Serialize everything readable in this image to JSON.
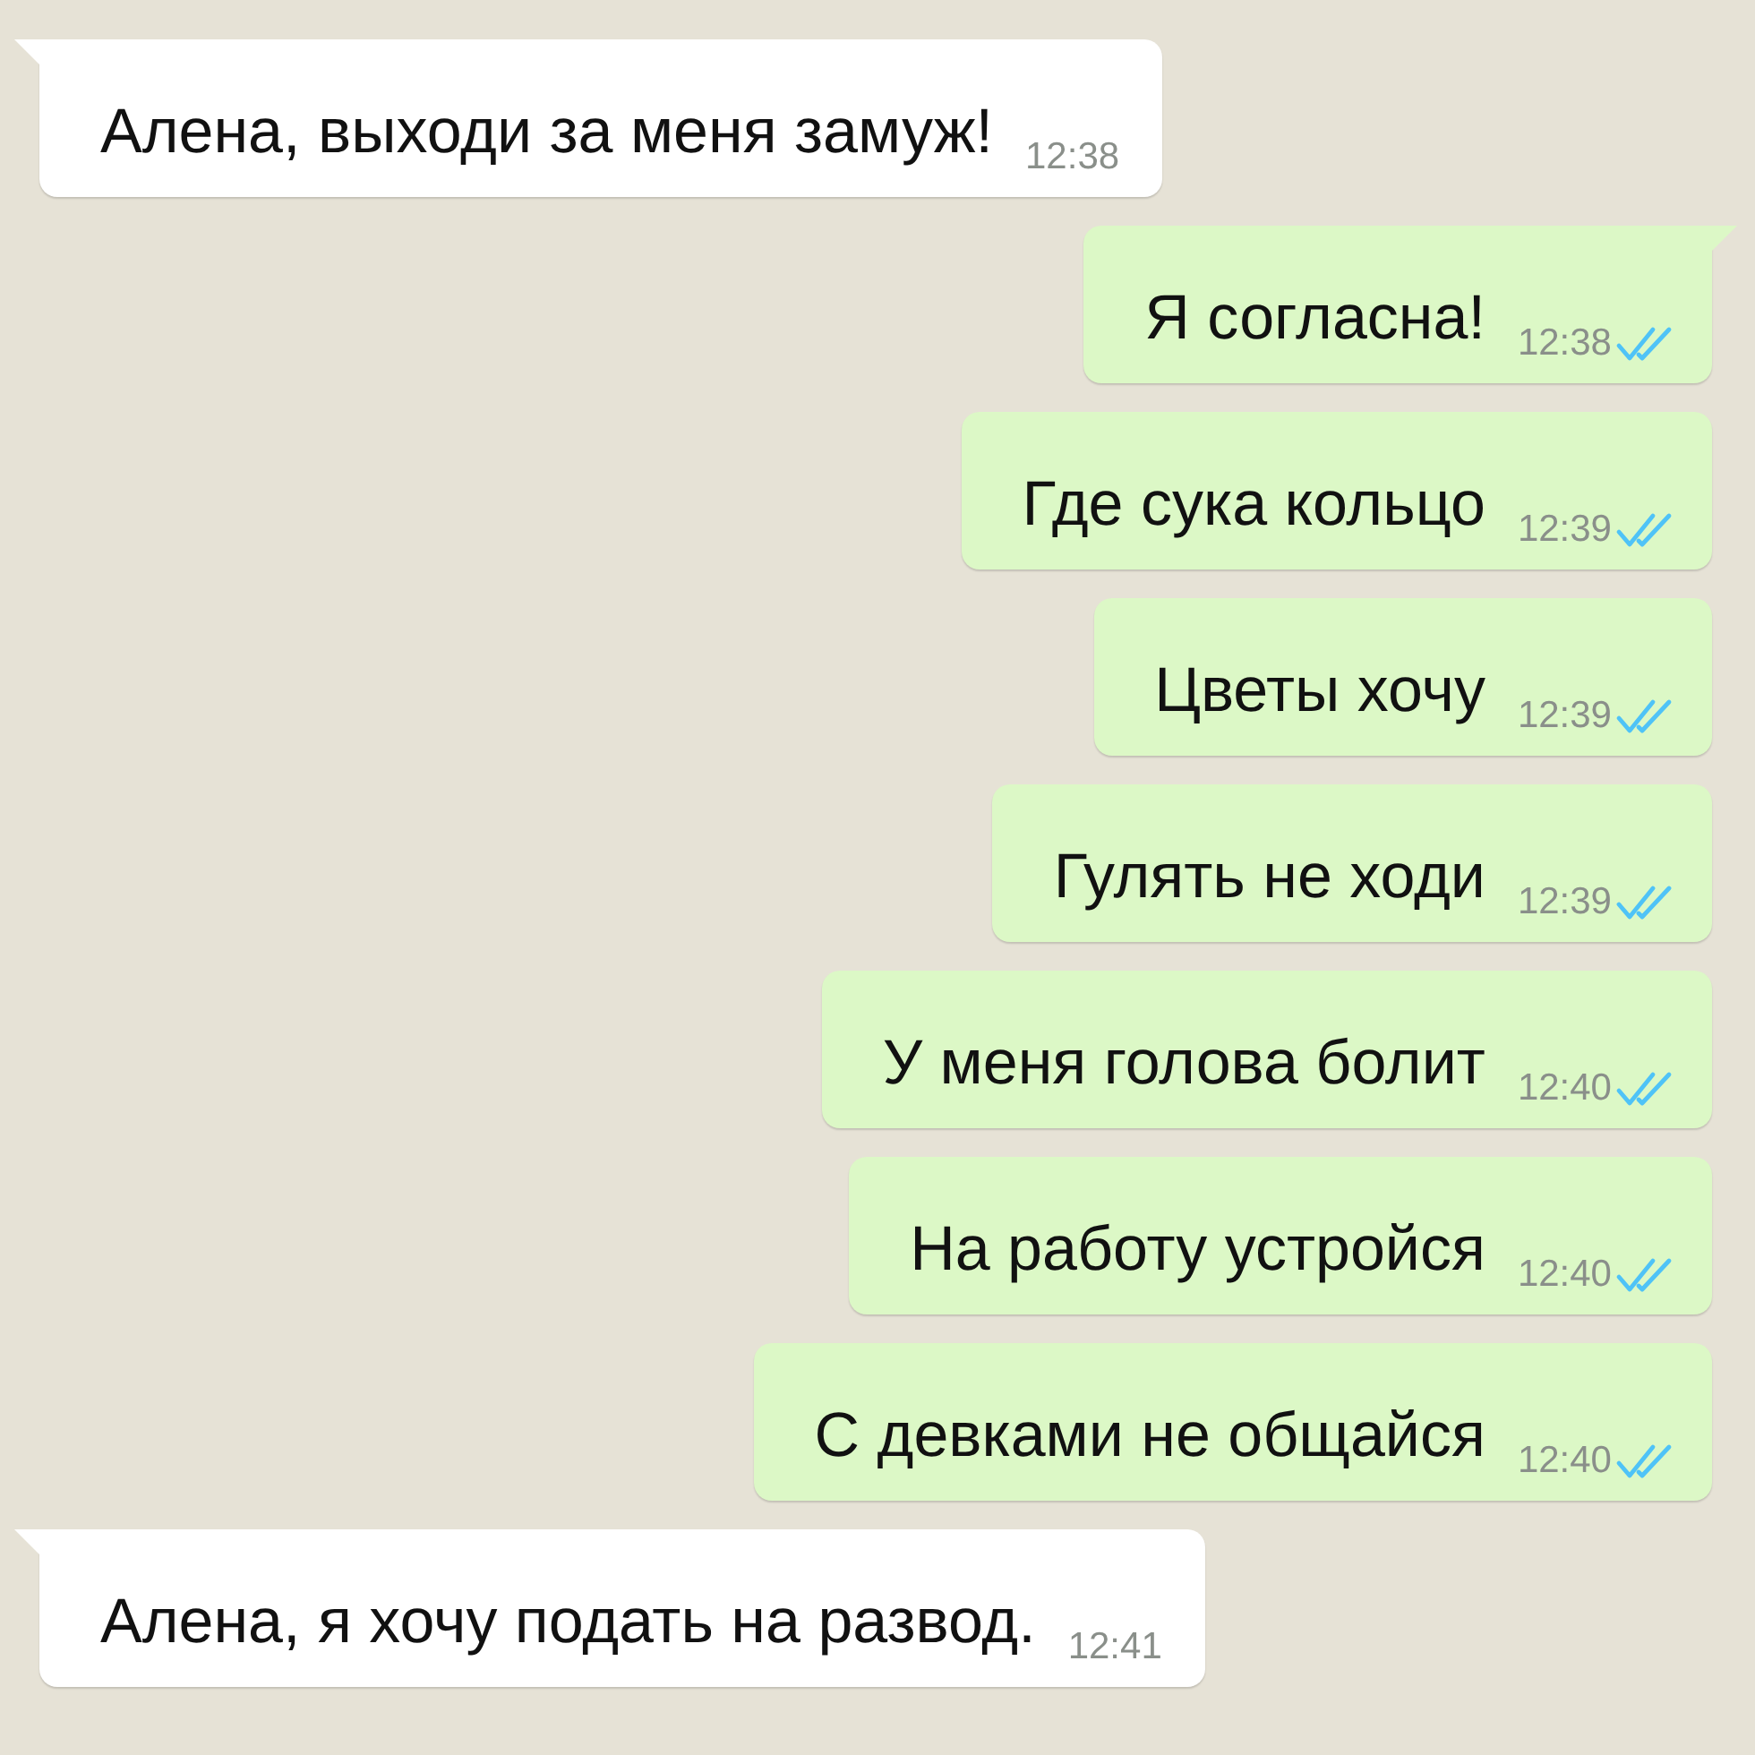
{
  "messages": [
    {
      "kind": "incoming",
      "text": "Алена, выходи за меня замуж!",
      "time": "12:38"
    },
    {
      "kind": "outgoing",
      "text": "Я согласна!",
      "time": "12:38",
      "read": true
    },
    {
      "kind": "outgoing",
      "text": "Где сука кольцо",
      "time": "12:39",
      "read": true
    },
    {
      "kind": "outgoing",
      "text": "Цветы хочу",
      "time": "12:39",
      "read": true
    },
    {
      "kind": "outgoing",
      "text": "Гулять не ходи",
      "time": "12:39",
      "read": true
    },
    {
      "kind": "outgoing",
      "text": "У меня голова болит",
      "time": "12:40",
      "read": true
    },
    {
      "kind": "outgoing",
      "text": "На работу устройся",
      "time": "12:40",
      "read": true
    },
    {
      "kind": "outgoing",
      "text": "С девками не общайся",
      "time": "12:40",
      "read": true
    },
    {
      "kind": "incoming",
      "text": "Алена, я хочу подать на развод.",
      "time": "12:41"
    }
  ]
}
